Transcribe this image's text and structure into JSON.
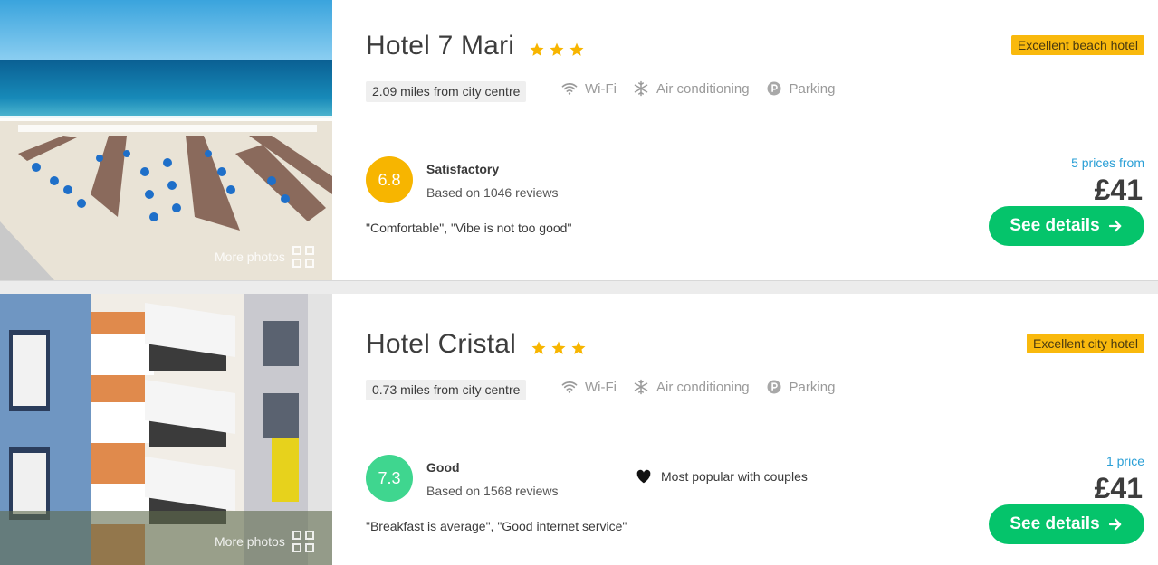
{
  "hotels": [
    {
      "name": "Hotel 7 Mari",
      "stars": 3,
      "badge": "Excellent beach hotel",
      "distance": "2.09 miles from city centre",
      "amenities": [
        "Wi-Fi",
        "Air conditioning",
        "Parking"
      ],
      "score": "6.8",
      "rating_label": "Satisfactory",
      "reviews": "Based on 1046 reviews",
      "quote": "\"Comfortable\", \"Vibe is not too good\"",
      "prices_from": "5 prices from",
      "price": "£41",
      "button_label": "See details",
      "more_photos": "More photos",
      "score_color": "#f7b500"
    },
    {
      "name": "Hotel Cristal",
      "stars": 3,
      "badge": "Excellent city hotel",
      "distance": "0.73 miles from city centre",
      "amenities": [
        "Wi-Fi",
        "Air conditioning",
        "Parking"
      ],
      "score": "7.3",
      "rating_label": "Good",
      "reviews": "Based on 1568 reviews",
      "popular": "Most popular with couples",
      "quote": "\"Breakfast is average\", \"Good internet service\"",
      "prices_from": "1 price",
      "price": "£41",
      "button_label": "See details",
      "more_photos": "More photos",
      "score_color": "#3fd68f"
    }
  ],
  "colors": {
    "accent_button": "#05c46b",
    "badge": "#f9b90d",
    "star": "#f7b500",
    "price_link": "#2a9fd6"
  }
}
